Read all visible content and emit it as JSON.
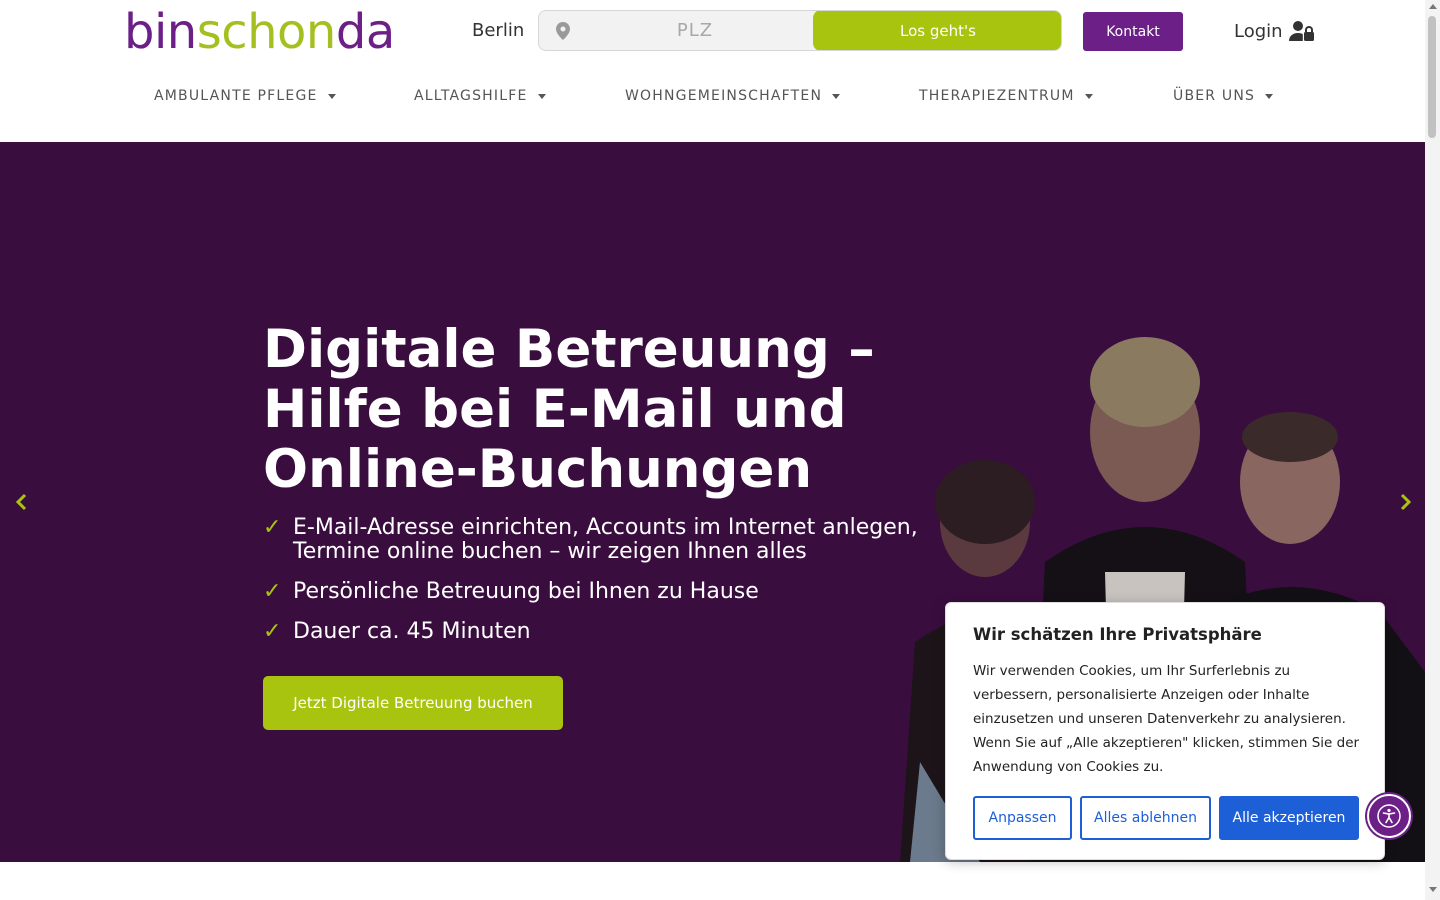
{
  "header": {
    "logo_part1": "bin",
    "logo_part2": "schon",
    "logo_part3": "da",
    "city": "Berlin",
    "search_placeholder": "PLZ",
    "search_button": "Los geht's",
    "contact_button": "Kontakt",
    "login_label": "Login"
  },
  "nav": {
    "items": [
      {
        "label": "AMBULANTE PFLEGE"
      },
      {
        "label": "ALLTAGSHILFE"
      },
      {
        "label": "WOHNGEMEINSCHAFTEN"
      },
      {
        "label": "THERAPIEZENTRUM"
      },
      {
        "label": "ÜBER UNS"
      }
    ]
  },
  "hero": {
    "title": "Digitale Betreuung – Hilfe bei E-Mail und Online-Buchungen",
    "bullets": [
      "E-Mail-Adresse einrichten, Accounts im Internet anlegen, Termine online buchen – wir zeigen Ihnen alles",
      "Persönliche Betreuung bei Ihnen zu Hause",
      "Dauer ca. 45 Minuten"
    ],
    "check_glyph": "✓",
    "cta_label": "Jetzt Digitale Betreuung buchen"
  },
  "cookie": {
    "title": "Wir schätzen Ihre Privatsphäre",
    "text": "Wir verwenden Cookies, um Ihr Surferlebnis zu verbessern, personalisierte Anzeigen oder Inhalte einzusetzen und unseren Datenverkehr zu analysieren. Wenn Sie auf „Alle akzeptieren\" klicken, stimmen Sie der Anwendung von Cookies zu.",
    "customize": "Anpassen",
    "reject": "Alles ablehnen",
    "accept": "Alle akzeptieren"
  },
  "colors": {
    "brand_purple": "#6b1f87",
    "brand_green": "#a9c40f",
    "hero_bg": "#3a0d3f",
    "cookie_blue": "#1d5fd6"
  },
  "icons": [
    "map-pin-icon",
    "user-lock-icon",
    "chevron-left-icon",
    "chevron-right-icon",
    "accessibility-icon"
  ]
}
